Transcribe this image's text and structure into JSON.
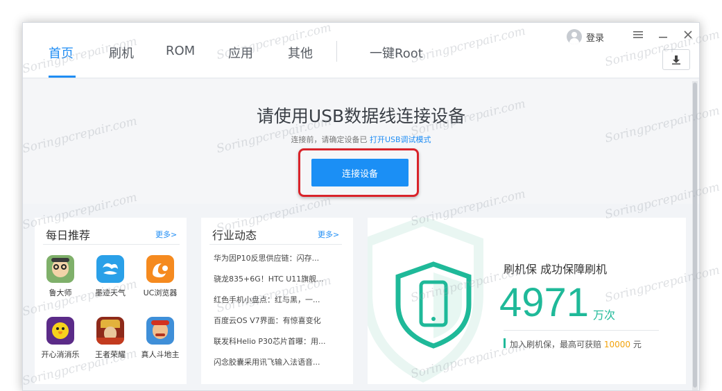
{
  "header": {
    "tabs": [
      {
        "label": "首页"
      },
      {
        "label": "刷机"
      },
      {
        "label": "ROM"
      },
      {
        "label": "应用"
      },
      {
        "label": "其他"
      },
      {
        "label": "一键Root"
      }
    ],
    "login_label": "登录"
  },
  "connect": {
    "title": "请使用USB数据线连接设备",
    "hint_prefix": "连接前，请确定设备已",
    "hint_link": "打开USB调试模式",
    "button_label": "连接设备"
  },
  "daily": {
    "title": "每日推荐",
    "more": "更多>",
    "apps": [
      {
        "label": "鲁大师"
      },
      {
        "label": "墨迹天气"
      },
      {
        "label": "UC浏览器"
      },
      {
        "label": "开心消消乐"
      },
      {
        "label": "王者荣耀"
      },
      {
        "label": "真人斗地主"
      }
    ]
  },
  "news": {
    "title": "行业动态",
    "more": "更多>",
    "items": [
      "华为因P10反思供应链：闪存...",
      "骁龙835+6G！HTC U11旗舰...",
      "红色手机小盘点：红与黑，一...",
      "百度云OS V7界面：有惊喜变化",
      "联发科Helio P30芯片首曝：用...",
      "闪念胶囊采用讯飞输入法语音..."
    ]
  },
  "promo": {
    "title": "刷机保  成功保障刷机",
    "number": "4971",
    "unit": "万次",
    "sub_prefix": "加入刷机保，最高可获赔",
    "sub_amount": "10000",
    "sub_suffix": "元"
  },
  "watermark": "Soringpcrepair.com",
  "colors": {
    "accent": "#1f8df4",
    "shield": "#1fb999",
    "highlight": "#d9232a",
    "amount": "#f2a20a"
  }
}
